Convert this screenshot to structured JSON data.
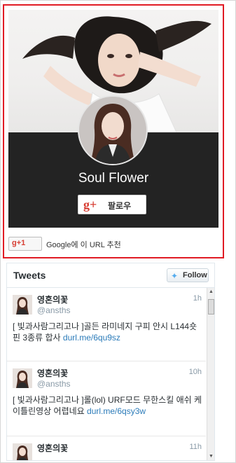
{
  "gplus": {
    "page_name": "Soul Flower",
    "follow_label": "팔로우",
    "follow_icon": "g+",
    "plusone_label": "g+1",
    "recommend_text": "Google에 이 URL 추천",
    "accent": "#e01b24"
  },
  "twitter": {
    "title": "Tweets",
    "follow_label": "Follow",
    "bird_icon": "twitter-bird-icon",
    "tweets": [
      {
        "name": "영혼의꽃",
        "handle": "@ansths",
        "time": "1h",
        "text": "[ 빛과사람그리고나 ]골든 라미네지 구피 안시 L144숏핀 3종류 합사 ",
        "link": "durl.me/6qu9sz"
      },
      {
        "name": "영혼의꽃",
        "handle": "@ansths",
        "time": "10h",
        "text": "[ 빛과사람그리고나 ]롤(lol) URF모드 무한스킬 애쉬 케이틀린영상 어렵네요 ",
        "link": "durl.me/6qsy3w"
      },
      {
        "name": "영혼의꽃",
        "handle": "@ansths",
        "time": "11h",
        "text": "",
        "link": ""
      }
    ]
  }
}
